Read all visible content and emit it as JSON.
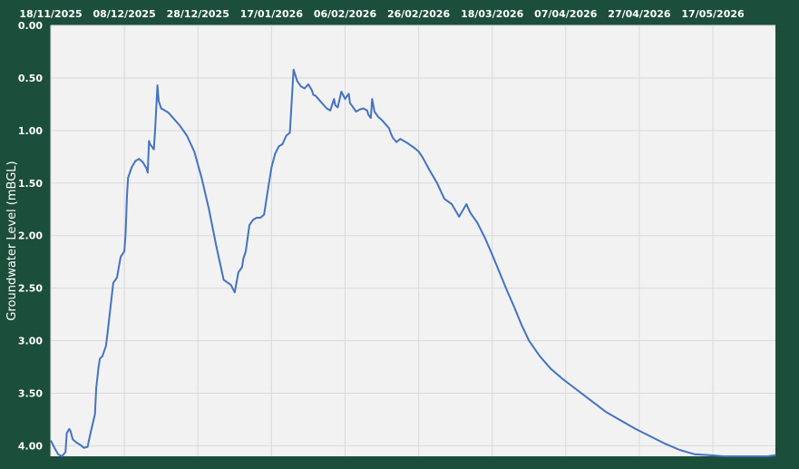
{
  "colors": {
    "background": "#1c4e3c",
    "plot_area": "#f2f2f2",
    "grid": "#d9d9d9",
    "line": "#4472c4",
    "text": "#ffffff"
  },
  "chart_data": {
    "type": "line",
    "title": "",
    "xlabel": "",
    "ylabel": "Groundwater Level (mBGL)",
    "x_axis_position": "top",
    "y_inverted": true,
    "grid": true,
    "legend": "none",
    "xlim": [
      "2025-11-18",
      "2026-06-03"
    ],
    "ylim": [
      0.0,
      4.1
    ],
    "x_ticks": [
      "18/11/2025",
      "08/12/2025",
      "28/12/2025",
      "17/01/2026",
      "06/02/2026",
      "26/02/2026",
      "18/03/2026",
      "07/04/2026",
      "27/04/2026",
      "17/05/2026"
    ],
    "y_ticks": [
      "0.00",
      "0.50",
      "1.00",
      "1.50",
      "2.00",
      "2.50",
      "3.00",
      "3.50",
      "4.00"
    ],
    "series": [
      {
        "color": "#4472c4",
        "x": [
          "2025-11-18",
          "2025-11-19",
          "2025-11-20",
          "2025-11-21",
          "2025-11-22",
          "2025-11-22",
          "2025-11-23",
          "2025-11-23",
          "2025-11-24",
          "2025-11-25",
          "2025-11-26",
          "2025-11-27",
          "2025-11-28",
          "2025-11-28",
          "2025-11-29",
          "2025-11-30",
          "2025-11-30",
          "2025-12-01",
          "2025-12-01",
          "2025-12-02",
          "2025-12-03",
          "2025-12-03",
          "2025-12-04",
          "2025-12-05",
          "2025-12-06",
          "2025-12-06",
          "2025-12-07",
          "2025-12-08",
          "2025-12-08",
          "2025-12-08",
          "2025-12-09",
          "2025-12-10",
          "2025-12-11",
          "2025-12-12",
          "2025-12-13",
          "2025-12-14",
          "2025-12-14",
          "2025-12-14",
          "2025-12-15",
          "2025-12-16",
          "2025-12-16",
          "2025-12-17",
          "2025-12-17",
          "2025-12-18",
          "2025-12-19",
          "2025-12-20",
          "2025-12-21",
          "2025-12-23",
          "2025-12-25",
          "2025-12-27",
          "2025-12-29",
          "2025-12-31",
          "2026-01-02",
          "2026-01-04",
          "2026-01-06",
          "2026-01-07",
          "2026-01-08",
          "2026-01-09",
          "2026-01-09",
          "2026-01-10",
          "2026-01-11",
          "2026-01-12",
          "2026-01-13",
          "2026-01-14",
          "2026-01-15",
          "2026-01-16",
          "2026-01-17",
          "2026-01-18",
          "2026-01-19",
          "2026-01-20",
          "2026-01-21",
          "2026-01-22",
          "2026-01-23",
          "2026-01-24",
          "2026-01-25",
          "2026-01-26",
          "2026-01-27",
          "2026-01-28",
          "2026-01-28",
          "2026-01-29",
          "2026-01-30",
          "2026-01-31",
          "2026-02-01",
          "2026-02-02",
          "2026-02-03",
          "2026-02-03",
          "2026-02-04",
          "2026-02-05",
          "2026-02-06",
          "2026-02-07",
          "2026-02-07",
          "2026-02-08",
          "2026-02-09",
          "2026-02-10",
          "2026-02-11",
          "2026-02-12",
          "2026-02-12",
          "2026-02-13",
          "2026-02-13",
          "2026-02-14",
          "2026-02-15",
          "2026-02-16",
          "2026-02-17",
          "2026-02-18",
          "2026-02-18",
          "2026-02-19",
          "2026-02-20",
          "2026-02-21",
          "2026-02-23",
          "2026-02-25",
          "2026-02-26",
          "2026-02-27",
          "2026-03-01",
          "2026-03-03",
          "2026-03-05",
          "2026-03-07",
          "2026-03-09",
          "2026-03-11",
          "2026-03-12",
          "2026-03-14",
          "2026-03-16",
          "2026-03-18",
          "2026-03-20",
          "2026-03-22",
          "2026-03-24",
          "2026-03-26",
          "2026-03-28",
          "2026-03-31",
          "2026-04-03",
          "2026-04-06",
          "2026-04-09",
          "2026-04-12",
          "2026-04-15",
          "2026-04-18",
          "2026-04-22",
          "2026-04-26",
          "2026-04-30",
          "2026-05-04",
          "2026-05-08",
          "2026-05-12",
          "2026-05-16",
          "2026-05-20",
          "2026-05-24",
          "2026-05-28",
          "2026-06-01",
          "2026-06-03"
        ],
        "values": [
          3.95,
          4.02,
          4.08,
          4.1,
          4.06,
          3.88,
          3.84,
          3.86,
          3.94,
          3.97,
          3.99,
          4.02,
          4.01,
          3.95,
          3.85,
          3.7,
          3.45,
          3.25,
          3.17,
          3.15,
          3.05,
          2.95,
          2.75,
          2.45,
          2.4,
          2.33,
          2.2,
          2.15,
          1.98,
          1.62,
          1.45,
          1.35,
          1.29,
          1.27,
          1.3,
          1.36,
          1.4,
          1.1,
          1.13,
          1.18,
          1.0,
          0.57,
          0.72,
          0.79,
          0.81,
          0.83,
          0.87,
          0.95,
          1.05,
          1.2,
          1.45,
          1.75,
          2.1,
          2.42,
          2.47,
          2.54,
          2.35,
          2.3,
          2.22,
          2.15,
          1.9,
          1.85,
          1.83,
          1.83,
          1.8,
          1.57,
          1.35,
          1.22,
          1.15,
          1.13,
          1.05,
          1.02,
          0.42,
          0.53,
          0.58,
          0.6,
          0.56,
          0.62,
          0.66,
          0.67,
          0.71,
          0.75,
          0.79,
          0.81,
          0.7,
          0.76,
          0.78,
          0.63,
          0.7,
          0.65,
          0.74,
          0.77,
          0.82,
          0.8,
          0.79,
          0.81,
          0.85,
          0.88,
          0.7,
          0.82,
          0.87,
          0.9,
          0.94,
          0.98,
          1.02,
          1.07,
          1.11,
          1.08,
          1.12,
          1.17,
          1.2,
          1.25,
          1.38,
          1.5,
          1.65,
          1.7,
          1.82,
          1.7,
          1.78,
          1.88,
          2.02,
          2.18,
          2.35,
          2.52,
          2.68,
          2.85,
          3.0,
          3.15,
          3.27,
          3.36,
          3.44,
          3.52,
          3.6,
          3.68,
          3.76,
          3.84,
          3.91,
          3.98,
          4.04,
          4.08,
          4.09,
          4.1,
          4.1,
          4.1,
          4.1,
          4.09
        ]
      }
    ]
  }
}
